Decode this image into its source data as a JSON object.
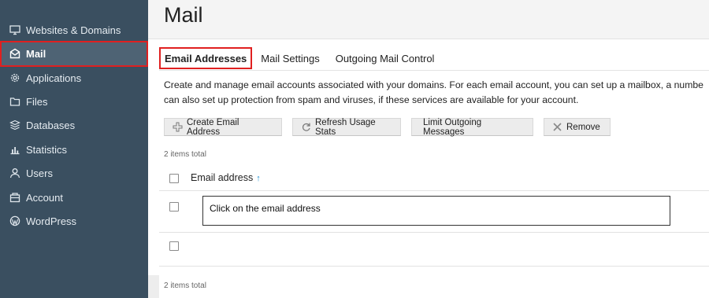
{
  "sidebar": {
    "items": [
      {
        "label": "Websites & Domains",
        "icon": "monitor-icon"
      },
      {
        "label": "Mail",
        "icon": "mail-icon",
        "active": true
      },
      {
        "label": "Applications",
        "icon": "gear-icon"
      },
      {
        "label": "Files",
        "icon": "folder-icon"
      },
      {
        "label": "Databases",
        "icon": "database-icon"
      },
      {
        "label": "Statistics",
        "icon": "bar-chart-icon"
      },
      {
        "label": "Users",
        "icon": "user-icon"
      },
      {
        "label": "Account",
        "icon": "account-icon"
      },
      {
        "label": "WordPress",
        "icon": "wordpress-icon"
      }
    ]
  },
  "page": {
    "title": "Mail"
  },
  "tabs": [
    {
      "label": "Email Addresses",
      "active": true
    },
    {
      "label": "Mail Settings"
    },
    {
      "label": "Outgoing Mail Control"
    }
  ],
  "description": {
    "line1": "Create and manage email accounts associated with your domains. For each email account, you can set up a mailbox, a numbe",
    "line2": "can also set up protection from spam and viruses, if these services are available for your account."
  },
  "toolbar": {
    "create_label": "Create Email Address",
    "refresh_label": "Refresh Usage Stats",
    "limit_label": "Limit Outgoing Messages",
    "remove_label": "Remove"
  },
  "list": {
    "items_total_top": "2 items total",
    "items_total_bottom": "2 items total",
    "column_header": "Email address",
    "sort_indicator": "↑"
  },
  "annotation": {
    "text": "Click on the email address"
  },
  "colors": {
    "sidebar_bg": "#3a4f60",
    "highlight": "#e02020",
    "sort_arrow": "#1f8fd0"
  }
}
